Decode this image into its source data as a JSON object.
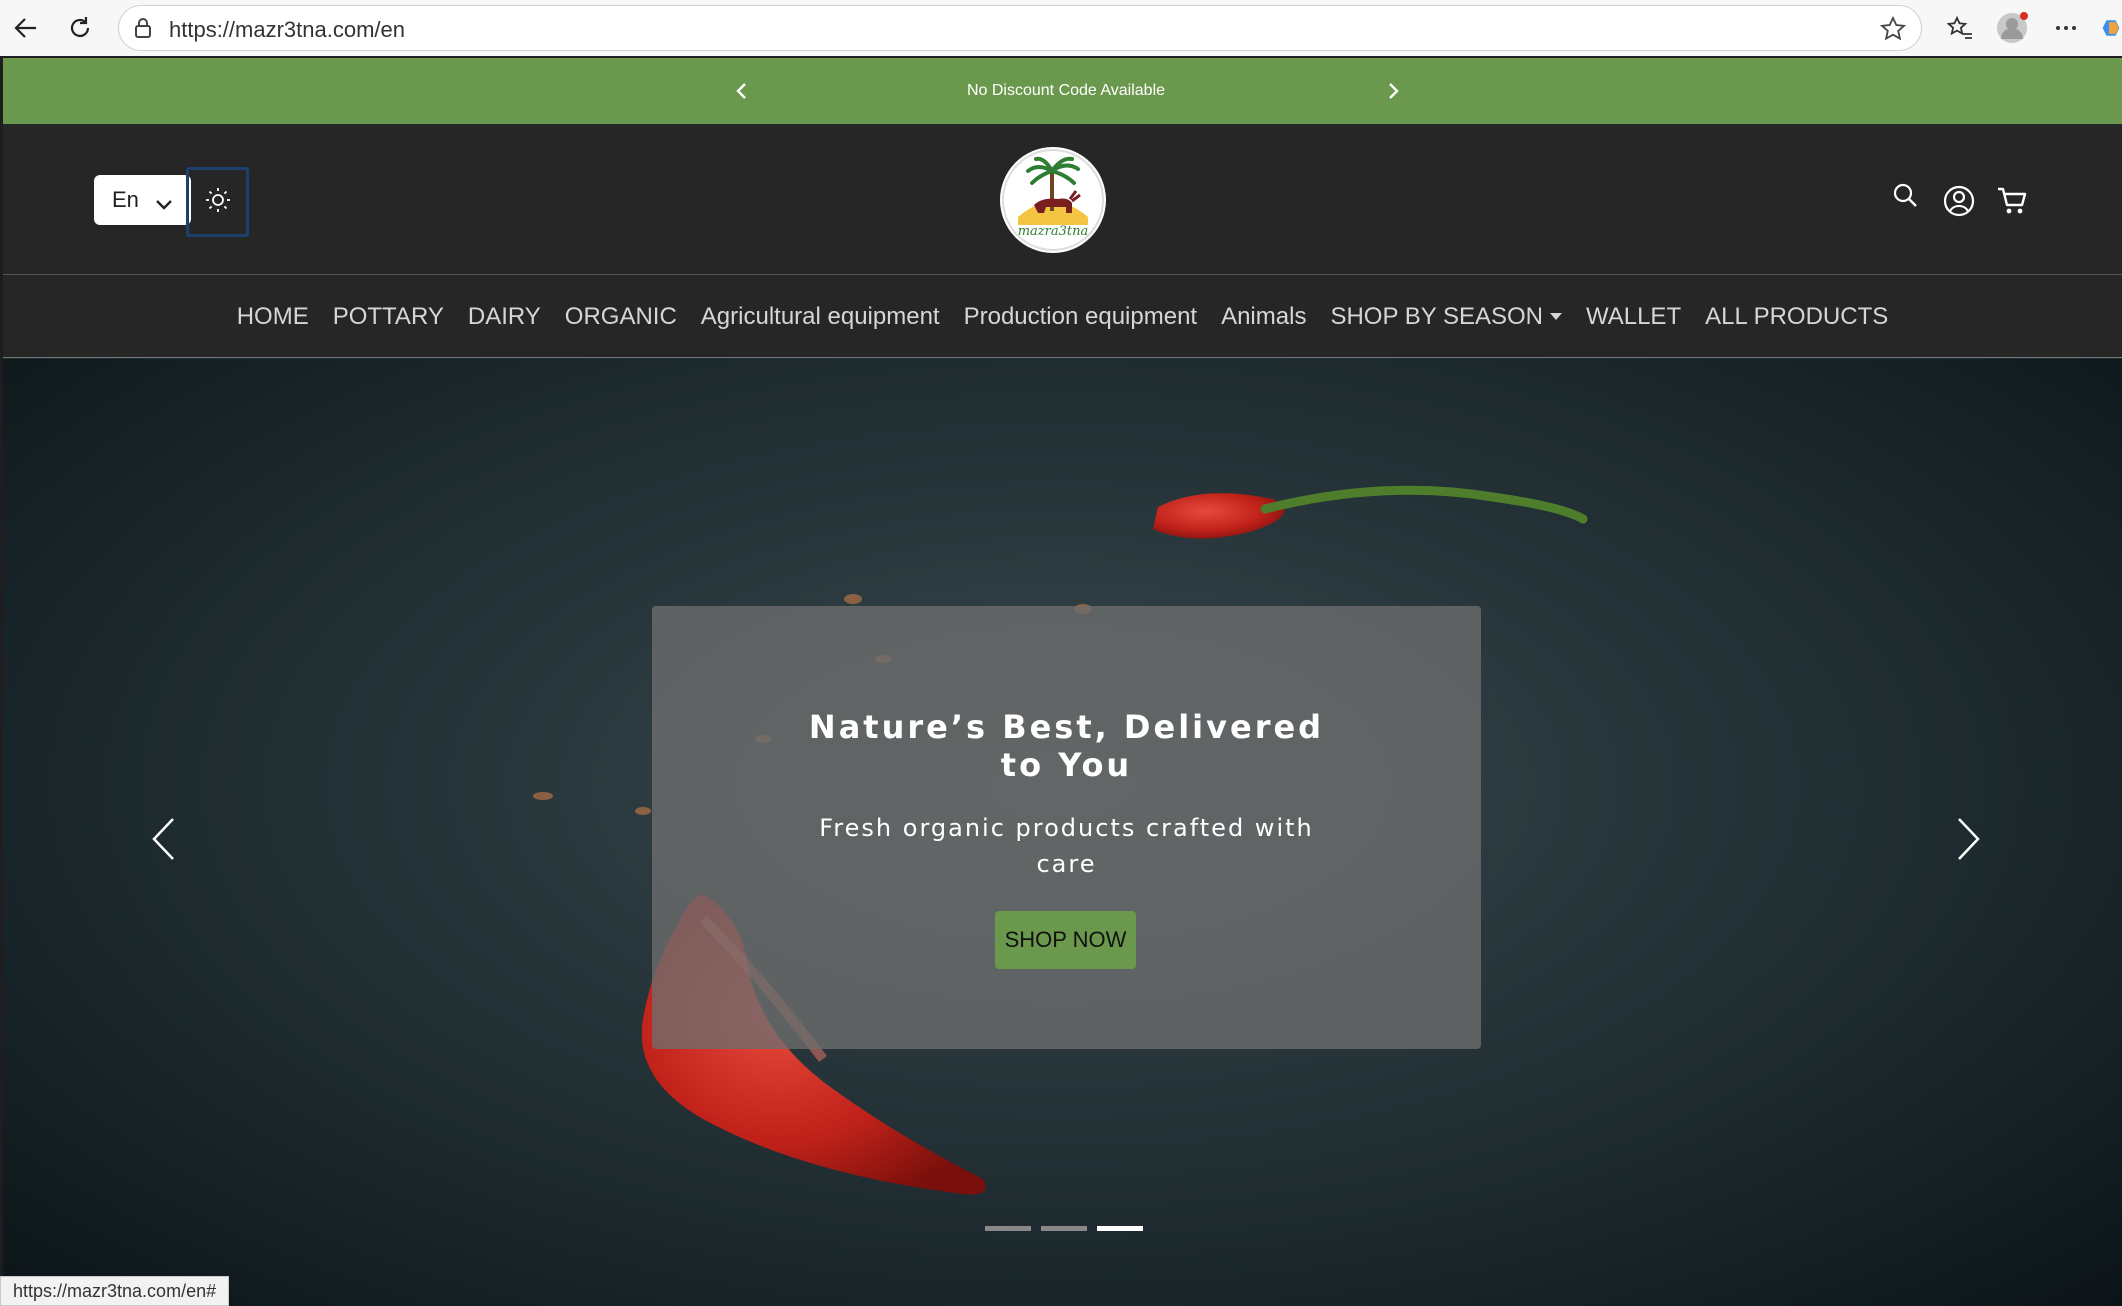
{
  "browser": {
    "url": "https://mazr3tna.com/en",
    "status_url": "https://mazr3tna.com/en#"
  },
  "promo": {
    "text": "No Discount Code Available"
  },
  "header": {
    "language": "En",
    "logo_text": "mazra3tna"
  },
  "nav": {
    "items": [
      {
        "label": "HOME"
      },
      {
        "label": "POTTARY"
      },
      {
        "label": "DAIRY"
      },
      {
        "label": "ORGANIC"
      },
      {
        "label": "Agricultural equipment"
      },
      {
        "label": "Production equipment"
      },
      {
        "label": "Animals"
      },
      {
        "label": "SHOP BY SEASON"
      },
      {
        "label": "WALLET"
      },
      {
        "label": "ALL PRODUCTS"
      }
    ]
  },
  "hero": {
    "title": "Nature’s Best, Delivered to You",
    "subtitle": "Fresh organic products crafted with care",
    "cta": "SHOP NOW",
    "slide_count": 3,
    "active_slide": 3
  },
  "colors": {
    "brand_green": "#6a994e",
    "header_bg": "#262626"
  }
}
